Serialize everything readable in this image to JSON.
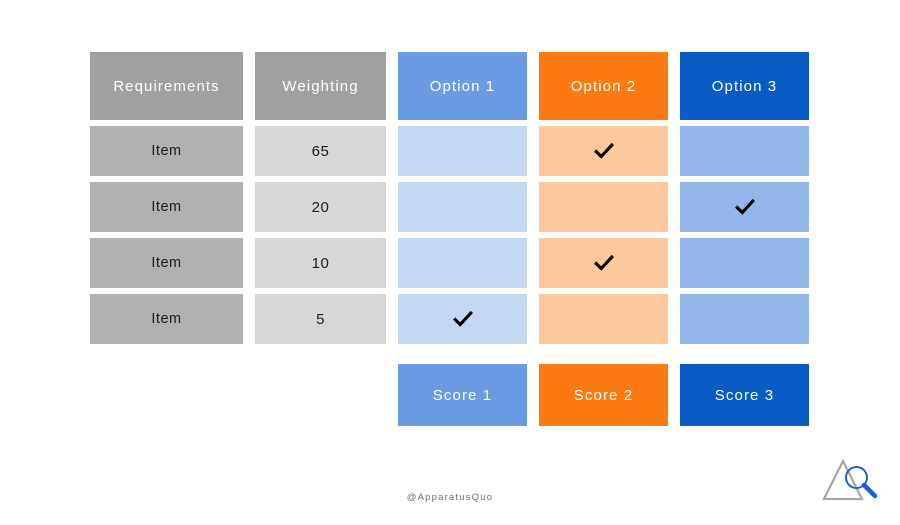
{
  "slide": {
    "type": "decision-matrix",
    "watermark": "@ApparatusQuo",
    "logo_name": "apparatus-quo-logo"
  },
  "colors": {
    "header_gray": "#a0a0a0",
    "item_gray": "#b1b1b1",
    "weight_gray": "#d7d7d7",
    "option1_header": "#6b9be3",
    "option1_body": "#c5d8f2",
    "option2_header": "#fc7a12",
    "option2_body": "#fbc79b",
    "option3_header": "#0a5bc4",
    "option3_body": "#93b5ea",
    "check_mark": "#000000",
    "logo_triangle": "#a6a6a6",
    "logo_glass": "#1f5fd0",
    "background": "#ffffff"
  },
  "headers": {
    "requirements": "Requirements",
    "weighting": "Weighting",
    "option1": "Option 1",
    "option2": "Option 2",
    "option3": "Option 3"
  },
  "rows": [
    {
      "requirement": "Item",
      "weighting": "65",
      "option1_checked": false,
      "option2_checked": true,
      "option3_checked": false
    },
    {
      "requirement": "Item",
      "weighting": "20",
      "option1_checked": false,
      "option2_checked": false,
      "option3_checked": true
    },
    {
      "requirement": "Item",
      "weighting": "10",
      "option1_checked": false,
      "option2_checked": true,
      "option3_checked": false
    },
    {
      "requirement": "Item",
      "weighting": "5",
      "option1_checked": true,
      "option2_checked": false,
      "option3_checked": false
    }
  ],
  "scores": {
    "score1": "Score 1",
    "score2": "Score 2",
    "score3": "Score 3"
  }
}
